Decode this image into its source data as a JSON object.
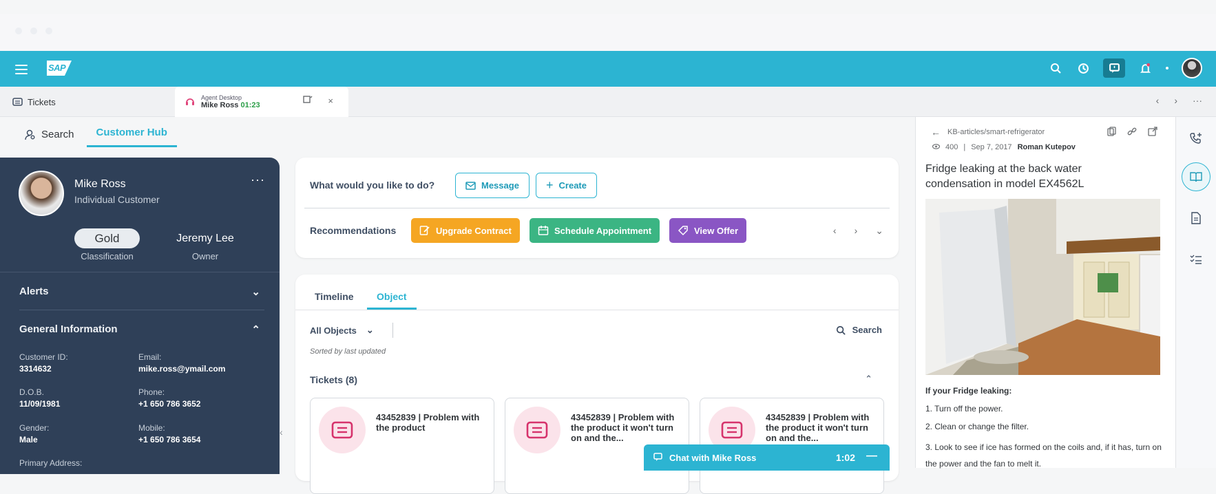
{
  "topbar": {
    "logo": "SAP"
  },
  "tabs": {
    "tickets": "Tickets",
    "agent_small": "Agent Desktop",
    "agent_name": "Mike Ross",
    "agent_time": "01:23",
    "close": "×"
  },
  "subnav": {
    "search": "Search",
    "hub": "Customer Hub"
  },
  "customer": {
    "name": "Mike Ross",
    "type": "Individual Customer",
    "more": "···",
    "classification_value": "Gold",
    "classification_label": "Classification",
    "owner_value": "Jeremy Lee",
    "owner_label": "Owner",
    "alerts": "Alerts",
    "general": "General Information",
    "fields": {
      "customer_id_label": "Customer ID:",
      "customer_id": "3314632",
      "email_label": "Email:",
      "email": "mike.ross@ymail.com",
      "dob_label": "D.O.B.",
      "dob": "11/09/1981",
      "phone_label": "Phone:",
      "phone": "+1 650 786 3652",
      "gender_label": "Gender:",
      "gender": "Male",
      "mobile_label": "Mobile:",
      "mobile": "+1 650 786 3654",
      "address_label": "Primary Address:"
    }
  },
  "actions": {
    "question": "What would you like to do?",
    "message": "Message",
    "create": "Create",
    "recommendations": "Recommendations",
    "upgrade": "Upgrade Contract",
    "schedule": "Schedule Appointment",
    "offer": "View Offer"
  },
  "objects": {
    "tab_timeline": "Timeline",
    "tab_object": "Object",
    "filter": "All Objects",
    "search": "Search",
    "sorted": "Sorted by last updated",
    "tickets_header": "Tickets (8)",
    "tickets": [
      {
        "title": "43452839 | Problem with the product"
      },
      {
        "title": "43452839 | Problem with the product it won't turn on and the..."
      },
      {
        "title": "43452839 | Problem with the product it won't turn on and the..."
      }
    ]
  },
  "kb": {
    "path": "KB-articles/smart-refrigerator",
    "views": "400",
    "date": "Sep 7, 2017",
    "author": "Roman Kutepov",
    "title": "Fridge leaking at the back water condensation in model EX4562L",
    "step_header": "If your Fridge leaking:",
    "steps": [
      "1. Turn off the power.",
      "2. Clean or change the filter.",
      "3. Look to see if ice has formed on the coils and, if it has, turn on the power and the fan to melt it."
    ]
  },
  "chat": {
    "label": "Chat with Mike Ross",
    "time": "1:02",
    "minimize": "—"
  },
  "colors": {
    "brand": "#2cb4d2",
    "panel": "#2f4058",
    "upgrade": "#f5a623",
    "schedule": "#3bb583",
    "offer": "#8a56c4"
  }
}
